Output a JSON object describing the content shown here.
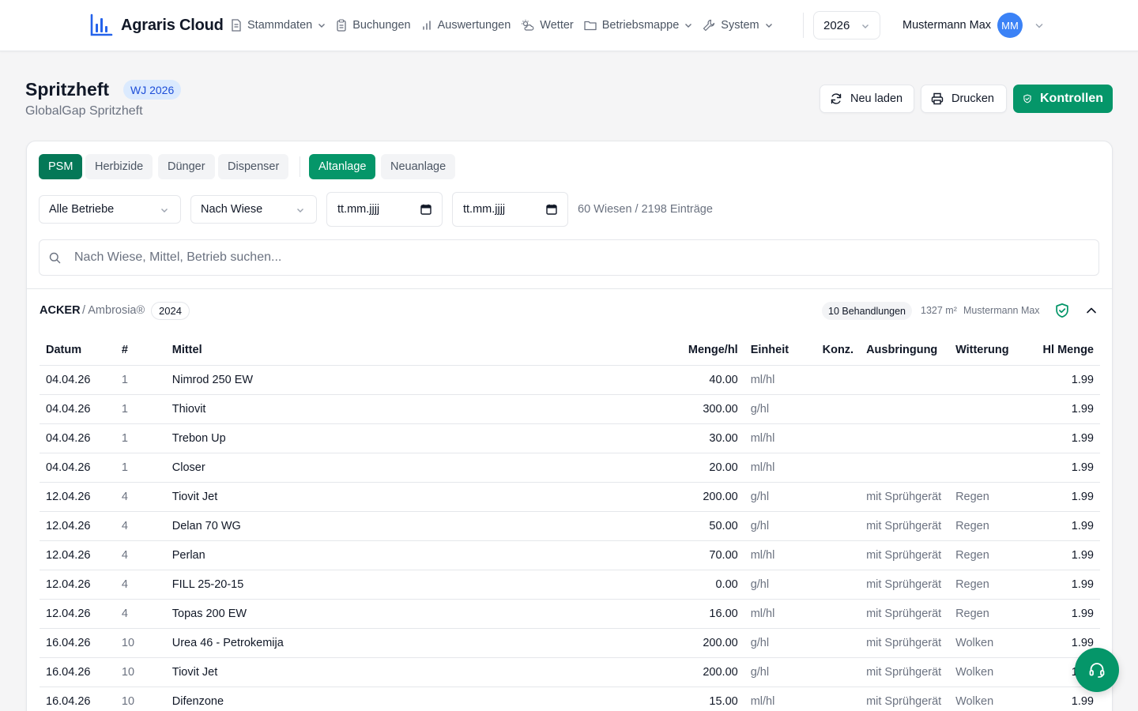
{
  "app": {
    "name": "Agraris Cloud",
    "brand_color": "#2563eb",
    "accent_color": "#059669"
  },
  "nav": {
    "items": [
      {
        "label": "Stammdaten",
        "icon": "document-icon",
        "dropdown": true
      },
      {
        "label": "Buchungen",
        "icon": "clipboard-icon",
        "dropdown": false
      },
      {
        "label": "Auswertungen",
        "icon": "bar-chart-icon",
        "dropdown": false
      },
      {
        "label": "Wetter",
        "icon": "weather-icon",
        "dropdown": false
      },
      {
        "label": "Betriebsmappe",
        "icon": "folder-icon",
        "dropdown": true
      },
      {
        "label": "System",
        "icon": "wrench-icon",
        "dropdown": true
      }
    ],
    "year": "2026",
    "user_name": "Mustermann Max",
    "user_initials": "MM"
  },
  "page": {
    "title": "Spritzheft",
    "badge": "WJ 2026",
    "subtitle": "GlobalGap Spritzheft",
    "actions": {
      "reload": "Neu laden",
      "print": "Drucken",
      "controls": "Kontrollen"
    }
  },
  "filters": {
    "type_tabs": [
      "PSM",
      "Herbizide",
      "Dünger",
      "Dispenser"
    ],
    "active_type": "PSM",
    "mode_tabs": [
      "Altanlage",
      "Neuanlage"
    ],
    "active_mode": "Altanlage",
    "betrieb_select": "Alle Betriebe",
    "group_select": "Nach Wiese",
    "date_from_placeholder": "tt.mm.jjjj",
    "date_to_placeholder": "tt.mm.jjjj",
    "count_text": "60 Wiesen / 2198 Einträge",
    "search_placeholder": "Nach Wiese, Mittel, Betrieb suchen..."
  },
  "group": {
    "name": "ACKER",
    "variety": "/ Ambrosia®",
    "year": "2024",
    "treatments_badge": "10 Behandlungen",
    "area": "1327 m²",
    "owner": "Mustermann Max"
  },
  "table": {
    "columns": [
      "Datum",
      "#",
      "Mittel",
      "Menge/hl",
      "Einheit",
      "Konz.",
      "Ausbringung",
      "Witterung",
      "Hl Menge"
    ],
    "rows": [
      {
        "datum": "04.04.26",
        "nr": "1",
        "mittel": "Nimrod 250 EW",
        "menge": "40.00",
        "einheit": "ml/hl",
        "konz": "",
        "ausbringung": "",
        "witterung": "",
        "hl": "1.99"
      },
      {
        "datum": "04.04.26",
        "nr": "1",
        "mittel": "Thiovit",
        "menge": "300.00",
        "einheit": "g/hl",
        "konz": "",
        "ausbringung": "",
        "witterung": "",
        "hl": "1.99"
      },
      {
        "datum": "04.04.26",
        "nr": "1",
        "mittel": "Trebon Up",
        "menge": "30.00",
        "einheit": "ml/hl",
        "konz": "",
        "ausbringung": "",
        "witterung": "",
        "hl": "1.99"
      },
      {
        "datum": "04.04.26",
        "nr": "1",
        "mittel": "Closer",
        "menge": "20.00",
        "einheit": "ml/hl",
        "konz": "",
        "ausbringung": "",
        "witterung": "",
        "hl": "1.99"
      },
      {
        "datum": "12.04.26",
        "nr": "4",
        "mittel": "Tiovit Jet",
        "menge": "200.00",
        "einheit": "g/hl",
        "konz": "",
        "ausbringung": "mit Sprühgerät",
        "witterung": "Regen",
        "hl": "1.99"
      },
      {
        "datum": "12.04.26",
        "nr": "4",
        "mittel": "Delan 70 WG",
        "menge": "50.00",
        "einheit": "g/hl",
        "konz": "",
        "ausbringung": "mit Sprühgerät",
        "witterung": "Regen",
        "hl": "1.99"
      },
      {
        "datum": "12.04.26",
        "nr": "4",
        "mittel": "Perlan",
        "menge": "70.00",
        "einheit": "ml/hl",
        "konz": "",
        "ausbringung": "mit Sprühgerät",
        "witterung": "Regen",
        "hl": "1.99"
      },
      {
        "datum": "12.04.26",
        "nr": "4",
        "mittel": "FILL 25-20-15",
        "menge": "0.00",
        "einheit": "g/hl",
        "konz": "",
        "ausbringung": "mit Sprühgerät",
        "witterung": "Regen",
        "hl": "1.99"
      },
      {
        "datum": "12.04.26",
        "nr": "4",
        "mittel": "Topas 200 EW",
        "menge": "16.00",
        "einheit": "ml/hl",
        "konz": "",
        "ausbringung": "mit Sprühgerät",
        "witterung": "Regen",
        "hl": "1.99"
      },
      {
        "datum": "16.04.26",
        "nr": "10",
        "mittel": "Urea 46 - Petrokemija",
        "menge": "200.00",
        "einheit": "g/hl",
        "konz": "",
        "ausbringung": "mit Sprühgerät",
        "witterung": "Wolken",
        "hl": "1.99"
      },
      {
        "datum": "16.04.26",
        "nr": "10",
        "mittel": "Tiovit Jet",
        "menge": "200.00",
        "einheit": "g/hl",
        "konz": "",
        "ausbringung": "mit Sprühgerät",
        "witterung": "Wolken",
        "hl": "1.99"
      },
      {
        "datum": "16.04.26",
        "nr": "10",
        "mittel": "Difenzone",
        "menge": "15.00",
        "einheit": "ml/hl",
        "konz": "",
        "ausbringung": "mit Sprühgerät",
        "witterung": "Wolken",
        "hl": "1.99"
      }
    ]
  },
  "support": {
    "icon": "headset-icon"
  }
}
